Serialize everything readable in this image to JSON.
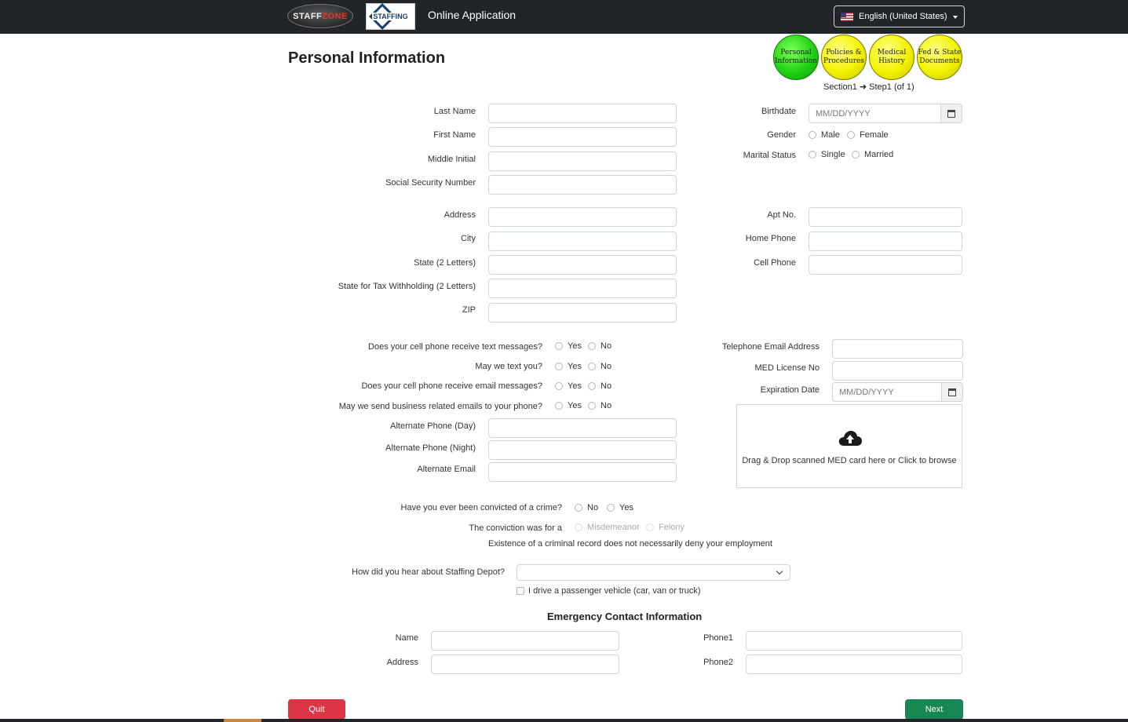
{
  "header": {
    "logo_staffzone_1": "STAFF",
    "logo_staffzone_2": "ZONE",
    "logo_staffing_depot": "STAFFING",
    "title": "Online Application",
    "language": "English (United States)"
  },
  "page_title": "Personal Information",
  "progress": {
    "steps": [
      {
        "label_1": "Personal",
        "label_2": "Information",
        "state": "current",
        "color": "#22d115"
      },
      {
        "label_1": "Policies &",
        "label_2": "Procedures",
        "state": "pending",
        "color": "#f2f200"
      },
      {
        "label_1": "Medical",
        "label_2": "History",
        "state": "pending",
        "color": "#f2f200"
      },
      {
        "label_1": "Fed & State",
        "label_2": "Documents",
        "state": "pending",
        "color": "#f2f200"
      }
    ],
    "section_label": "Section1",
    "step_label": "Step1 (of 1)"
  },
  "personal": {
    "last_name": "Last Name",
    "first_name": "First Name",
    "middle_initial": "Middle Initial",
    "ssn": "Social Security Number",
    "birthdate": "Birthdate",
    "birthdate_placeholder": "MM/DD/YYYY",
    "gender": "Gender",
    "gender_male": "Male",
    "gender_female": "Female",
    "marital_status": "Marital Status",
    "marital_single": "Single",
    "marital_married": "Married"
  },
  "address": {
    "address": "Address",
    "city": "City",
    "state": "State (2 Letters)",
    "tax_state": "State for Tax Withholding (2 Letters)",
    "zip": "ZIP",
    "apt": "Apt No.",
    "home_phone": "Home Phone",
    "cell_phone": "Cell Phone"
  },
  "contact": {
    "q_text_messages": "Does your cell phone receive text messages?",
    "q_text_you": "May we text you?",
    "q_email_messages": "Does your cell phone receive email messages?",
    "q_business_emails": "May we send business related emails to your phone?",
    "yes": "Yes",
    "no": "No",
    "alt_phone_day": "Alternate Phone (Day)",
    "alt_phone_night": "Alternate Phone (Night)",
    "alt_email": "Alternate Email",
    "telephone_email": "Telephone Email Address",
    "med_license": "MED License No",
    "expiration_date": "Expiration Date",
    "expiration_placeholder": "MM/DD/YYYY",
    "dropzone_text": "Drag & Drop scanned MED card here or Click to browse"
  },
  "criminal": {
    "question": "Have you ever been convicted of a crime?",
    "no": "No",
    "yes": "Yes",
    "conviction_for": "The conviction was for a",
    "misdemeanor": "Misdemeanor",
    "felony": "Felony",
    "notice": "Existence of a criminal record does not necessarily deny your employment"
  },
  "referral": {
    "question": "How did you hear about Staffing Depot?",
    "selected": "",
    "vehicle_checkbox": "I drive a passenger vehicle (car, van or truck)"
  },
  "emergency": {
    "title": "Emergency Contact Information",
    "name": "Name",
    "address": "Address",
    "phone1": "Phone1",
    "phone2": "Phone2"
  },
  "buttons": {
    "quit": "Quit",
    "next": "Next"
  }
}
